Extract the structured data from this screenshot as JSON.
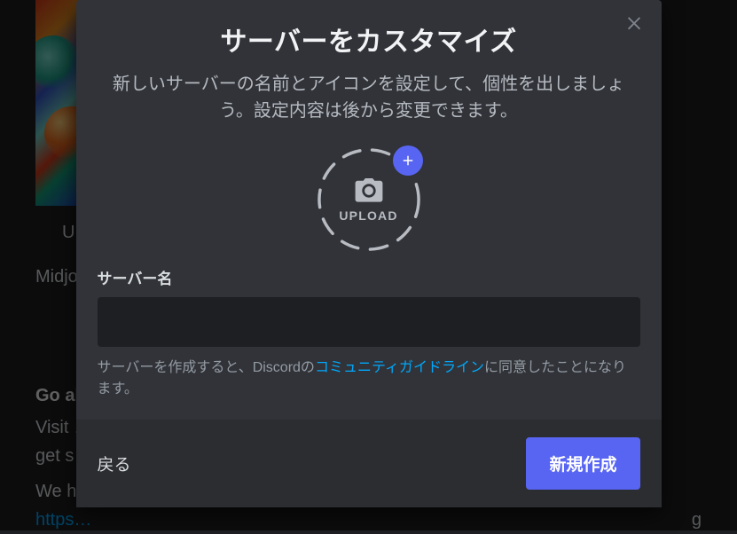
{
  "background": {
    "caption_fragment": "U",
    "para1": "Midjo… … …e an im… numb…",
    "bold_heading": "Go al…",
    "para2_line1": "Visit …",
    "para2_line2": "get s…",
    "para3_prefix": "We ho…",
    "para3_link": "https…",
    "para3_suffix": "g"
  },
  "modal": {
    "title": "サーバーをカスタマイズ",
    "subtitle": "新しいサーバーの名前とアイコンを設定して、個性を出しましょう。設定内容は後から変更できます。",
    "upload_label": "UPLOAD",
    "server_name_label": "サーバー名",
    "server_name_value": "",
    "terms_prefix": "サーバーを作成すると、Discordの",
    "terms_link_text": "コミュニティガイドライン",
    "terms_suffix": "に同意したことになります。",
    "back_button": "戻る",
    "create_button": "新規作成"
  },
  "icons": {
    "close": "close-icon",
    "camera": "camera-icon",
    "plus": "plus-icon"
  }
}
